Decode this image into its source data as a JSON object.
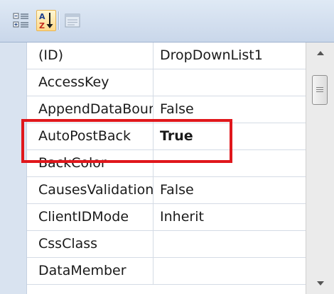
{
  "toolbar": {
    "buttons": [
      {
        "icon": "categorized-icon",
        "pressed": false
      },
      {
        "icon": "alphabetical-sort-icon",
        "pressed": true
      },
      {
        "icon": "property-pages-icon",
        "enabled": false
      }
    ]
  },
  "properties": [
    {
      "name": "(ID)",
      "value": "DropDownList1",
      "bold": false
    },
    {
      "name": "AccessKey",
      "value": "",
      "bold": false
    },
    {
      "name": "AppendDataBound",
      "value": "False",
      "bold": false
    },
    {
      "name": "AutoPostBack",
      "value": "True",
      "bold": true
    },
    {
      "name": "BackColor",
      "value": "",
      "bold": false
    },
    {
      "name": "CausesValidation",
      "value": "False",
      "bold": false
    },
    {
      "name": "ClientIDMode",
      "value": "Inherit",
      "bold": false
    },
    {
      "name": "CssClass",
      "value": "",
      "bold": false
    },
    {
      "name": "DataMember",
      "value": "",
      "bold": false
    }
  ],
  "highlight": {
    "color": "#e0171c"
  },
  "colors": {
    "toolbar_bg": "#d3dfee",
    "gutter": "#d9e3f0",
    "grid_line": "#d4dbe5"
  }
}
